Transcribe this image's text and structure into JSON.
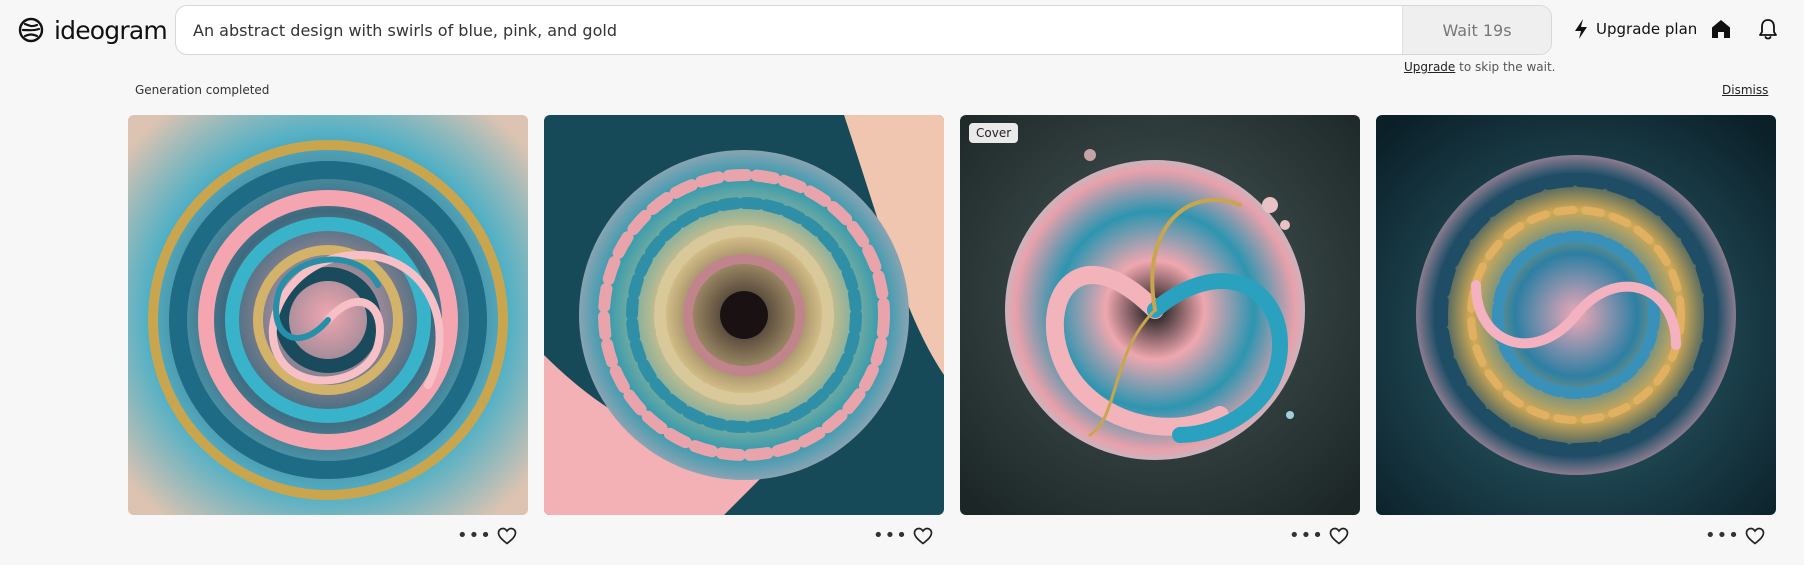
{
  "brand": {
    "name": "ideogram"
  },
  "search": {
    "value": "An abstract design with swirls of blue, pink, and gold",
    "wait_label": "Wait 19s"
  },
  "upgrade_note": {
    "link": "Upgrade",
    "rest": " to skip the wait."
  },
  "nav": {
    "upgrade_plan_label": "Upgrade plan",
    "icons": [
      "bolt-icon",
      "home-icon",
      "bell-icon"
    ]
  },
  "generation": {
    "status": "Generation completed",
    "dismiss_label": "Dismiss"
  },
  "results": [
    {
      "badge": "",
      "palette": [
        "#f2a4ad",
        "#1f5d74",
        "#38b0c7",
        "#c9a64e"
      ]
    },
    {
      "badge": "",
      "palette": [
        "#f3b0b5",
        "#164a58",
        "#2e9ab0",
        "#d8c28a"
      ]
    },
    {
      "badge": "Cover",
      "palette": [
        "#2b3838",
        "#efa7af",
        "#2d95b0",
        "#c9a64e"
      ]
    },
    {
      "badge": "",
      "palette": [
        "#143443",
        "#f0a8b8",
        "#2d7fa3",
        "#d2aa55"
      ]
    }
  ],
  "colors": {
    "background": "#f7f7f7",
    "text": "#222222"
  }
}
